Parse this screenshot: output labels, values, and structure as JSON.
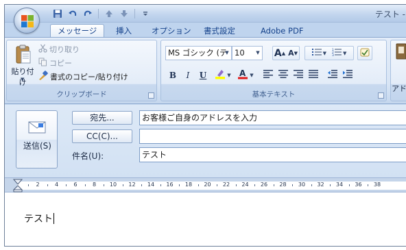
{
  "window": {
    "title": "テスト -"
  },
  "quick_access": [
    {
      "icon": "save-icon"
    },
    {
      "icon": "undo-icon"
    },
    {
      "icon": "redo-icon"
    },
    {
      "icon": "up-arrow-icon"
    },
    {
      "icon": "down-arrow-icon"
    },
    {
      "icon": "customize-qat-icon"
    }
  ],
  "tabs": [
    "メッセージ",
    "挿入",
    "オプション",
    "書式設定",
    "Adobe PDF"
  ],
  "active_tab": "メッセージ",
  "ribbon": {
    "clipboard": {
      "group_label": "クリップボード",
      "paste_label": "貼り付け",
      "cut_label": "切り取り",
      "copy_label": "コピー",
      "format_painter_label": "書式のコピー/貼り付け"
    },
    "basic_text": {
      "group_label": "基本テキスト",
      "font_name": "MS ゴシック (テ",
      "font_size": "10",
      "bold": "B",
      "italic": "I",
      "underline": "U",
      "grow_font": "A",
      "shrink_font": "A"
    },
    "next_group_label": "アド"
  },
  "compose": {
    "send_label": "送信(S)",
    "to_button": "宛先...",
    "cc_button": "CC(C)...",
    "subject_label": "件名(U):",
    "to_value": "お客様ご自身のアドレスを入力",
    "cc_value": "",
    "subject_value": "テスト"
  },
  "ruler": {
    "numbers": [
      "2",
      "4",
      "6",
      "8",
      "10",
      "12",
      "14",
      "16",
      "18",
      "20",
      "22",
      "24",
      "26",
      "28",
      "30",
      "32",
      "34",
      "36",
      "38"
    ]
  },
  "body": {
    "text": "テスト"
  },
  "colors": {
    "ribbon_blue": "#c9dcf1",
    "tab_text": "#15428b",
    "font_color_red": "#e01818",
    "highlight_yellow": "#ffff00"
  }
}
